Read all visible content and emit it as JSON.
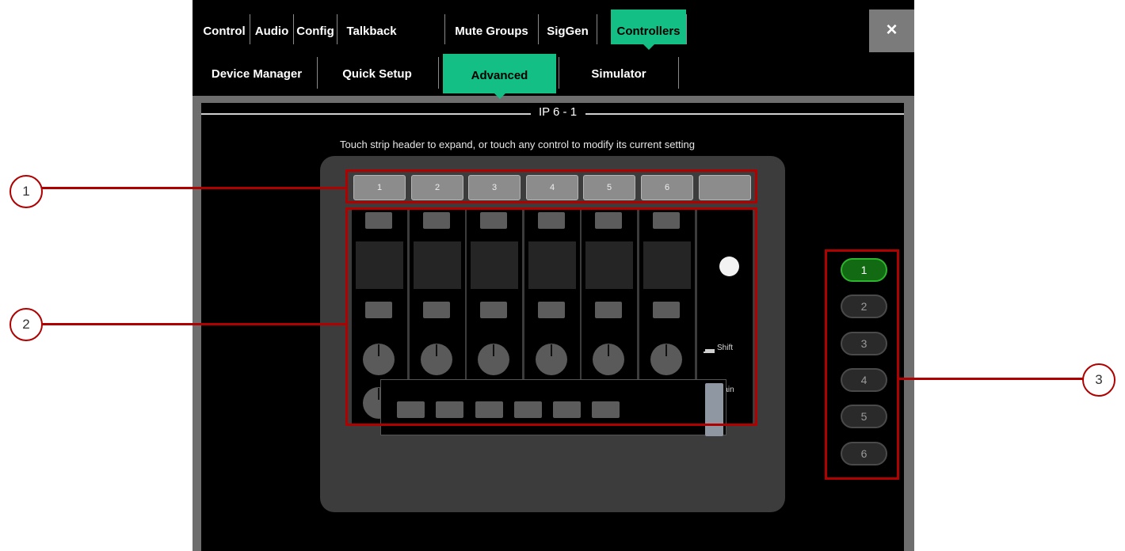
{
  "top_tabs": [
    "Control",
    "Audio",
    "Config",
    "Talkback",
    "Mute Groups",
    "SigGen",
    "Controllers"
  ],
  "top_active": "Controllers",
  "close_glyph": "×",
  "sub_tabs": [
    "Device Manager",
    "Quick Setup",
    "Advanced",
    "Simulator"
  ],
  "sub_active": "Advanced",
  "panel": {
    "title": "IP 6 - 1",
    "instruction": "Touch strip header to expand, or touch any control to modify its current setting"
  },
  "strip_headers": [
    "1",
    "2",
    "3",
    "4",
    "5",
    "6",
    ""
  ],
  "side_labels": {
    "shift": "Shift",
    "main": "Main"
  },
  "page_buttons": [
    "1",
    "2",
    "3",
    "4",
    "5",
    "6"
  ],
  "page_selected": "1",
  "callouts": [
    "1",
    "2",
    "3"
  ],
  "colors": {
    "accent": "#13bf85",
    "page_active": "#126a12",
    "annotation": "#b00000"
  },
  "icons": {
    "close": "close-icon",
    "shift": "shift-key-icon",
    "main": "main-key-icon"
  }
}
